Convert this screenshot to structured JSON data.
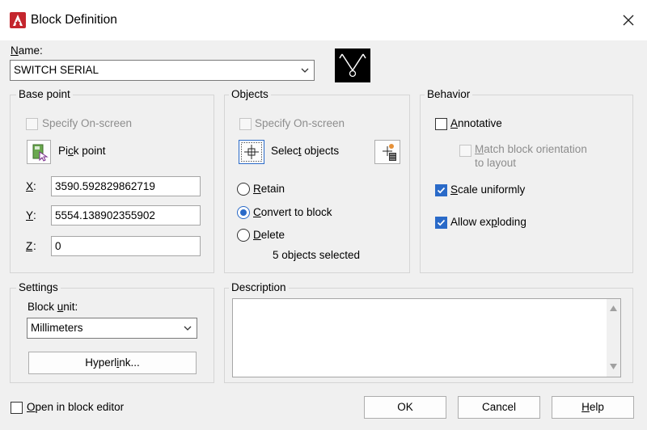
{
  "window": {
    "title": "Block Definition"
  },
  "name_field": {
    "label_u": "N",
    "label_rest": "ame:",
    "value": "SWITCH SERIAL"
  },
  "base_point": {
    "title": "Base point",
    "specify_onscreen": "Specify On-screen",
    "pick_point_pre": "Pi",
    "pick_point_u": "c",
    "pick_point_post": "k point",
    "x_label": "X",
    "x_value": "3590.592829862719",
    "y_label": "Y",
    "y_value": "5554.138902355902",
    "z_label": "Z",
    "z_value": "0"
  },
  "objects": {
    "title": "Objects",
    "specify_onscreen": "Specify On-screen",
    "select_objects_pre": "Selec",
    "select_objects_u": "t",
    "select_objects_post": " objects",
    "retain_u": "R",
    "retain_rest": "etain",
    "convert_u": "C",
    "convert_rest": "onvert to block",
    "delete_u": "D",
    "delete_rest": "elete",
    "selected_count": "5 objects selected"
  },
  "behavior": {
    "title": "Behavior",
    "annotative_u": "A",
    "annotative_rest": "nnotative",
    "match_u": "M",
    "match_rest": "atch block orientation",
    "match_line2": "to layout",
    "scale_u": "S",
    "scale_rest": "cale uniformly",
    "explode_pre": "Allow ex",
    "explode_u": "p",
    "explode_post": "loding",
    "annotative_checked": false,
    "scale_checked": true,
    "explode_checked": true
  },
  "settings": {
    "title": "Settings",
    "block_unit_pre": "Block ",
    "block_unit_u": "u",
    "block_unit_post": "nit:",
    "unit_value": "Millimeters",
    "hyperlink_pre": "Hyperl",
    "hyperlink_u": "i",
    "hyperlink_post": "nk..."
  },
  "description": {
    "title": "Description",
    "value": ""
  },
  "footer": {
    "open_editor_u": "O",
    "open_editor_rest": "pen in block editor",
    "ok_label": "OK",
    "cancel_label": "Cancel",
    "help_u": "H",
    "help_rest": "elp"
  },
  "colors": {
    "accent": "#2a6ac8",
    "app_icon": "#c4262e"
  },
  "icons": [
    "autocad-app-icon",
    "close-icon",
    "block-preview-icon",
    "pick-point-icon",
    "select-objects-icon",
    "quick-select-icon",
    "chevron-down-icon",
    "scroll-up-icon",
    "scroll-down-icon",
    "checkmark-icon"
  ]
}
